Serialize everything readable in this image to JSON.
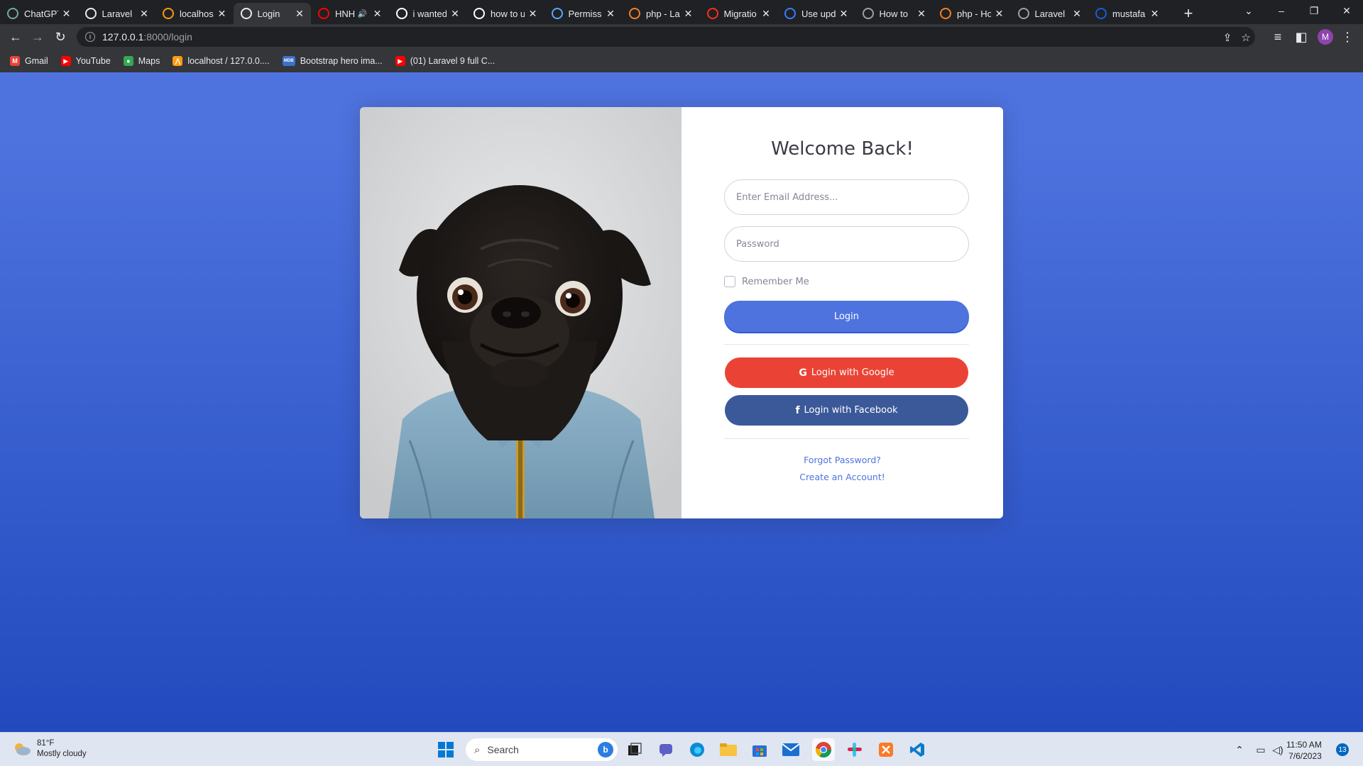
{
  "browser": {
    "tabs": [
      {
        "title": "ChatGPT",
        "icon": "chatgpt-icon",
        "color": "#74aa9c"
      },
      {
        "title": "Laravel",
        "icon": "globe-icon",
        "color": "#e8eaed"
      },
      {
        "title": "localhos",
        "icon": "phpmyadmin-icon",
        "color": "#f89c0e"
      },
      {
        "title": "Login",
        "icon": "globe-icon",
        "color": "#e8eaed",
        "active": true
      },
      {
        "title": "HNH",
        "icon": "youtube-icon",
        "color": "#ff0000"
      },
      {
        "title": "i wanted",
        "icon": "google-icon",
        "color": "#ffffff"
      },
      {
        "title": "how to u",
        "icon": "google-icon",
        "color": "#ffffff"
      },
      {
        "title": "Permissi",
        "icon": "spatie-icon",
        "color": "#5aa7ff"
      },
      {
        "title": "php - La",
        "icon": "stackoverflow-icon",
        "color": "#f48024"
      },
      {
        "title": "Migratio",
        "icon": "laravel-icon",
        "color": "#ff2d20"
      },
      {
        "title": "Use upd",
        "icon": "d-icon",
        "color": "#3e7bfa"
      },
      {
        "title": "How to",
        "icon": "github-icon",
        "color": "#9aa0a6"
      },
      {
        "title": "php - Ho",
        "icon": "stackoverflow-icon",
        "color": "#f48024"
      },
      {
        "title": "Laravel",
        "icon": "laravel-dev-icon",
        "color": "#9aa0a6"
      },
      {
        "title": "mustafa",
        "icon": "bitwarden-icon",
        "color": "#175ddc"
      }
    ],
    "url_host": "127.0.0.1",
    "url_path": ":8000/login",
    "profile_initial": "M",
    "bookmarks": [
      {
        "label": "Gmail",
        "icon": "gmail-icon",
        "color": "#ea4335",
        "glyph": "M"
      },
      {
        "label": "YouTube",
        "icon": "youtube-icon",
        "color": "#ff0000",
        "glyph": "▶"
      },
      {
        "label": "Maps",
        "icon": "maps-icon",
        "color": "#34a853",
        "glyph": "●"
      },
      {
        "label": "localhost / 127.0.0....",
        "icon": "phpmyadmin-icon",
        "color": "#f89c0e",
        "glyph": "⋀"
      },
      {
        "label": "Bootstrap hero ima...",
        "icon": "mdb-icon",
        "color": "#3b71ca",
        "glyph": "MDB"
      },
      {
        "label": "(01) Laravel 9 full C...",
        "icon": "youtube-icon",
        "color": "#ff0000",
        "glyph": "▶"
      }
    ]
  },
  "login": {
    "title": "Welcome Back!",
    "email_placeholder": "Enter Email Address...",
    "password_placeholder": "Password",
    "remember_label": "Remember Me",
    "login_button": "Login",
    "google_button": "Login with Google",
    "facebook_button": "Login with Facebook",
    "forgot_link": "Forgot Password?",
    "register_link": "Create an Account!",
    "colors": {
      "primary": "#4e73df",
      "google": "#ea4335",
      "facebook": "#3b5998"
    }
  },
  "taskbar": {
    "weather_temp": "81°F",
    "weather_desc": "Mostly cloudy",
    "search_label": "Search",
    "time": "11:50 AM",
    "date": "7/6/2023",
    "notification_count": "13"
  }
}
